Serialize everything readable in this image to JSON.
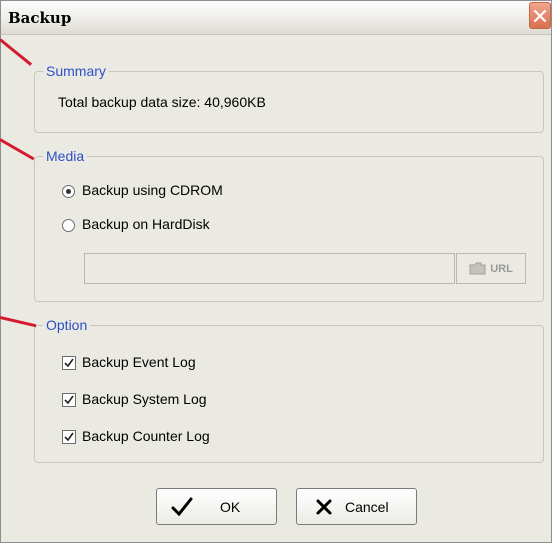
{
  "window": {
    "title": "Backup"
  },
  "summary": {
    "legend": "Summary",
    "total_label": "Total backup data size: 40,960KB"
  },
  "media": {
    "legend": "Media",
    "options": [
      {
        "label": "Backup using CDROM",
        "selected": true
      },
      {
        "label": "Backup on HardDisk",
        "selected": false
      }
    ],
    "path_value": "",
    "url_button_label": "URL"
  },
  "option": {
    "legend": "Option",
    "items": [
      {
        "label": "Backup Event Log",
        "checked": true
      },
      {
        "label": "Backup System Log",
        "checked": true
      },
      {
        "label": "Backup Counter Log",
        "checked": true
      }
    ]
  },
  "buttons": {
    "ok_label": "OK",
    "cancel_label": "Cancel"
  },
  "colors": {
    "legend": "#2d50c8",
    "pointer": "#d31a2e",
    "dialog_bg": "#ebeae2"
  },
  "icons": {
    "close": "close-icon",
    "ok": "checkmark-icon",
    "cancel": "x-icon",
    "url": "folder-icon"
  }
}
